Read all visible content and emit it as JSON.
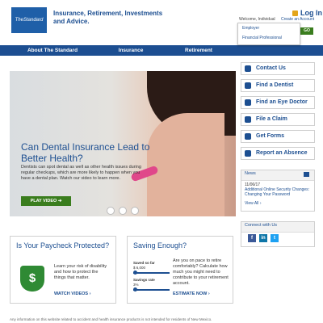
{
  "header": {
    "logo_text": "TheStandard",
    "tagline": "Insurance, Retirement, Investments and Advice.",
    "welcome_text": "Welcome, Individual",
    "create_account": "Create an Account",
    "login_label": "Log In",
    "dropdown_items": [
      "Employer",
      "Financial Professional"
    ],
    "go_label": "GO"
  },
  "nav": {
    "items": [
      "About The Standard",
      "Insurance",
      "Retirement"
    ]
  },
  "hero": {
    "title": "Can Dental Insurance Lead to Better Health?",
    "body": "Dentists can spot dental as well as other health issues during regular checkups, which are more likely to happen when you have a dental plan. Watch our video to learn more.",
    "button_label": "PLAY VIDEO"
  },
  "sidebar": {
    "links": [
      "Contact Us",
      "Find a Dentist",
      "Find an Eye Doctor",
      "File a Claim",
      "Get Forms",
      "Report an Absence"
    ]
  },
  "news": {
    "heading": "News",
    "date": "11/06/17",
    "headline": "Additional Online Security Changes: Changing Your Password",
    "view_all": "View All"
  },
  "connect": {
    "heading": "Connect with Us",
    "networks": [
      "f",
      "in",
      "t"
    ]
  },
  "promo_paycheck": {
    "title": "Is Your Paycheck Protected?",
    "text": "Learn your risk of disability and how to protect the things that matter.",
    "link": "WATCH VIDEOS"
  },
  "promo_saving": {
    "title": "Saving Enough?",
    "text": "Are you on pace to retire comfortably? Calculate how much you might need to contribute to your retirement account.",
    "saved_label": "Saved so far",
    "saved_value": "$ 6,000",
    "rate_label": "Savings rate",
    "rate_value": "3%",
    "link": "ESTIMATE NOW"
  },
  "footer": {
    "disclaimer": "Any information on this website related to accident and health insurance products is not intended for residents of New Mexico."
  },
  "colors": {
    "brand_blue": "#1c4e91",
    "go_green": "#3a7d1e",
    "accent_gold": "#e3a51a"
  }
}
